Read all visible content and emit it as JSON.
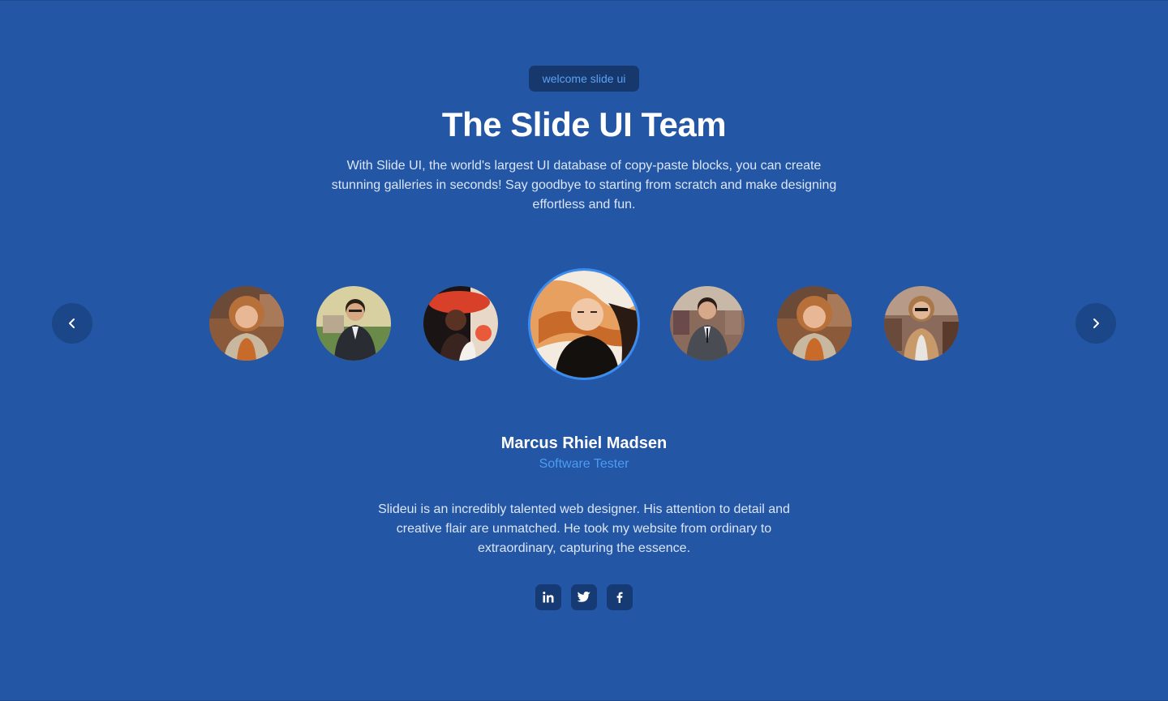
{
  "header": {
    "badge_label": "welcome slide ui",
    "title": "The Slide UI Team",
    "intro": "With Slide UI, the world's largest UI database of copy-paste blocks, you can create stunning galleries in seconds! Say goodbye to starting from scratch and make designing effortless and fun."
  },
  "carousel": {
    "prev_icon": "chevron-left-icon",
    "next_icon": "chevron-right-icon",
    "active_index": 3,
    "avatars": [
      {
        "portrait": "woman-curly-hair"
      },
      {
        "portrait": "man-suit-glasses"
      },
      {
        "portrait": "woman-red-hat"
      },
      {
        "portrait": "woman-flowing-hair"
      },
      {
        "portrait": "man-suit-smiling"
      },
      {
        "portrait": "woman-curly-hair"
      },
      {
        "portrait": "woman-sunglasses"
      }
    ]
  },
  "testimonial": {
    "name": "Marcus Rhiel Madsen",
    "role": "Software Tester",
    "quote": "Slideui is an incredibly talented web designer. His attention to detail and creative flair are unmatched. He took my website from ordinary to extraordinary, capturing the essence."
  },
  "social": [
    {
      "icon": "linkedin-icon"
    },
    {
      "icon": "twitter-icon"
    },
    {
      "icon": "facebook-icon"
    }
  ],
  "colors": {
    "background": "#2356a5",
    "badge_bg": "#17386d",
    "accent": "#4c9cf5",
    "active_ring": "#3b8bf0"
  }
}
